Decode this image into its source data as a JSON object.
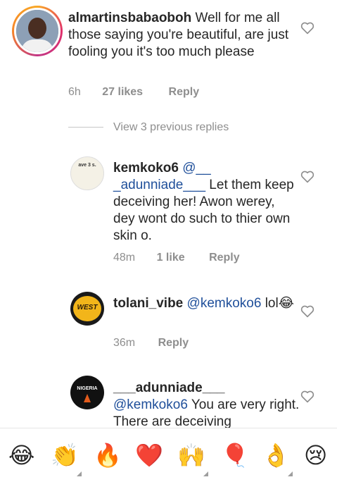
{
  "comments": [
    {
      "username": "almartinsbabaoboh",
      "text": " Well for me all those saying you're beautiful, are just fooling you it's too much please",
      "time": "6h",
      "likes": "27 likes",
      "reply": "Reply"
    }
  ],
  "view_replies": "View 3 previous replies",
  "replies": [
    {
      "username": "kemkoko6",
      "mention": "@__ _adunniade___",
      "text": " Let them keep deceiving her! Awon werey, dey wont do such to thier own skin o.",
      "time": "48m",
      "likes": "1 like",
      "reply": "Reply",
      "avatar_text": "ave 3 s."
    },
    {
      "username": "tolani_vibe",
      "mention": "@kemkoko6",
      "text": " lol😂",
      "time": "36m",
      "reply": "Reply",
      "avatar_text": "WEST"
    },
    {
      "username": "___adunniade___",
      "mention": "@kemkoko6",
      "text": " You are very right. There are deceiving",
      "avatar_text": "NIGERIA"
    }
  ],
  "emoji_bar": [
    "😂",
    "👏",
    "🔥",
    "❤️",
    "🙌",
    "🎈",
    "👌",
    "😢"
  ],
  "colors": {
    "mention": "#1f4f9a",
    "meta": "#8e8e8e",
    "text": "#262626",
    "heart": "#8e8e8e"
  },
  "icons": [
    "heart-outline-icon"
  ]
}
